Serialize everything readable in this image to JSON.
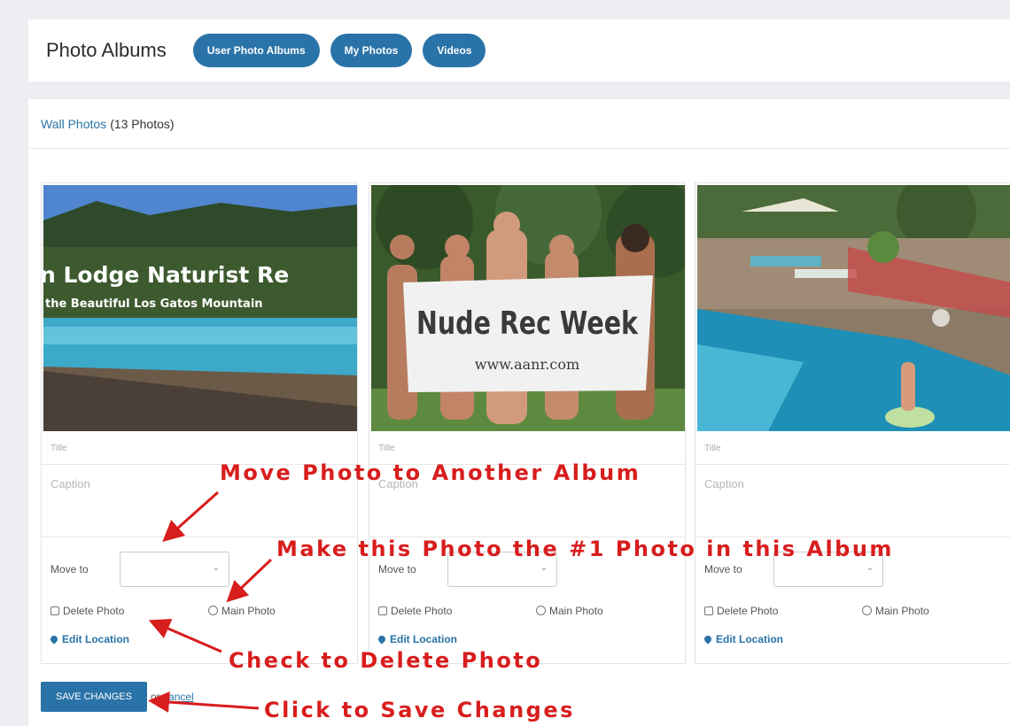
{
  "header": {
    "title": "Photo Albums",
    "tabs": [
      "User Photo Albums",
      "My Photos",
      "Videos"
    ]
  },
  "album": {
    "name": "Wall Photos",
    "count": "(13 Photos)"
  },
  "photos": [
    {
      "overlay_line1": "n Lodge Naturist Re",
      "overlay_line2": "the Beautiful Los Gatos Mountain",
      "title_placeholder": "Title",
      "caption_placeholder": "Caption",
      "move_label": "Move to",
      "delete_label": "Delete Photo",
      "main_label": "Main Photo",
      "edit_location": "Edit Location"
    },
    {
      "banner_main": "Nude Rec Week",
      "banner_url": "www.aanr.com",
      "title_placeholder": "Title",
      "caption_placeholder": "Caption",
      "move_label": "Move to",
      "delete_label": "Delete Photo",
      "main_label": "Main Photo",
      "edit_location": "Edit Location"
    },
    {
      "title_placeholder": "Title",
      "caption_placeholder": "Caption",
      "move_label": "Move to",
      "delete_label": "Delete Photo",
      "main_label": "Main Photo",
      "edit_location": "Edit Location"
    }
  ],
  "actions": {
    "save": "SAVE CHANGES",
    "or": "or",
    "cancel": "cancel"
  },
  "annotations": {
    "move": "Move Photo to Another Album",
    "main": "Make this Photo the #1 Photo in this Album",
    "delete": "Check to Delete Photo",
    "save": "Click to Save Changes"
  },
  "colors": {
    "accent": "#2a73a8",
    "annotation": "#d81d1d"
  }
}
